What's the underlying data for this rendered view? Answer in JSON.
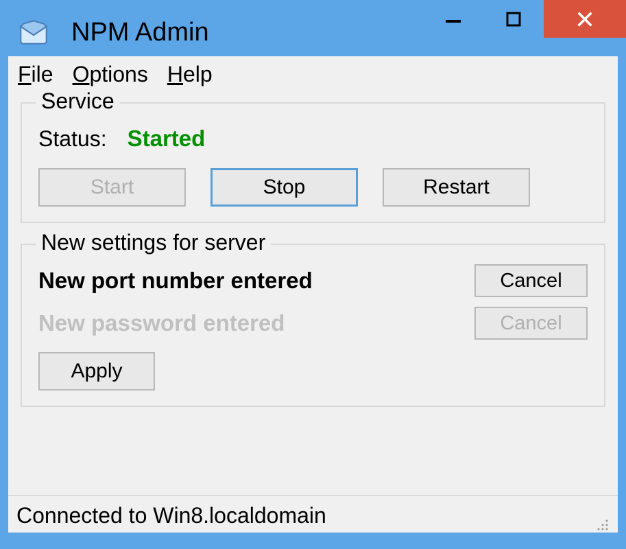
{
  "window": {
    "title": "NPM Admin"
  },
  "menu": {
    "file": "File",
    "options": "Options",
    "help": "Help"
  },
  "service_group": {
    "title": "Service",
    "status_label": "Status:",
    "status_value": "Started",
    "start_label": "Start",
    "stop_label": "Stop",
    "restart_label": "Restart"
  },
  "settings_group": {
    "title": "New settings for server",
    "port_label": "New port number entered",
    "password_label": "New password entered",
    "cancel_label": "Cancel",
    "apply_label": "Apply"
  },
  "statusbar": {
    "text": "Connected to Win8.localdomain"
  },
  "colors": {
    "frame": "#5ca6e8",
    "close": "#d9523c",
    "status_started": "#009000"
  }
}
